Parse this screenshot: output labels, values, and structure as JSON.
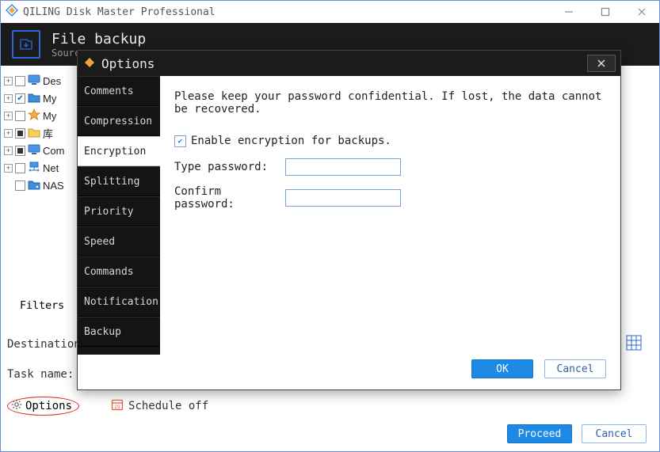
{
  "window": {
    "title": "QILING Disk Master Professional"
  },
  "header": {
    "title": "File backup",
    "subtitle": "Sourc"
  },
  "tree": {
    "items": [
      {
        "label": "Des",
        "check": "empty",
        "icon": "monitor",
        "color": "#2e7fd6"
      },
      {
        "label": "My",
        "check": "checked",
        "icon": "folder-docs",
        "color": "#2e7fd6"
      },
      {
        "label": "My",
        "check": "empty",
        "icon": "star",
        "color": "#f2a639"
      },
      {
        "label": "库",
        "check": "mixed",
        "icon": "folder",
        "color": "#f2c24b"
      },
      {
        "label": "Com",
        "check": "mixed",
        "icon": "monitor",
        "color": "#2e7fd6"
      },
      {
        "label": "Net",
        "check": "empty",
        "icon": "network",
        "color": "#2e7fd6"
      },
      {
        "label": "NAS",
        "check": "empty",
        "icon": "nas",
        "color": "#2e7fd6",
        "leaf": true
      }
    ]
  },
  "filters_button": "Filters",
  "labels": {
    "destination": "Destination:",
    "task_name": "Task name:"
  },
  "bottom": {
    "options": "Options",
    "schedule": "Schedule off"
  },
  "main_buttons": {
    "proceed": "Proceed",
    "cancel": "Cancel"
  },
  "dialog": {
    "title": "Options",
    "tabs": [
      "Comments",
      "Compression",
      "Encryption",
      "Splitting",
      "Priority",
      "Speed",
      "Commands",
      "Notification",
      "Backup"
    ],
    "active_tab": "Encryption",
    "warning": "Please keep your password confidential. If lost, the data cannot be recovered.",
    "enable_label": "Enable encryption for backups.",
    "enable_checked": true,
    "type_password_label": "Type password:",
    "confirm_password_label": "Confirm password:",
    "type_password_value": "",
    "confirm_password_value": "",
    "ok": "OK",
    "cancel": "Cancel",
    "close_tooltip": "Close"
  }
}
